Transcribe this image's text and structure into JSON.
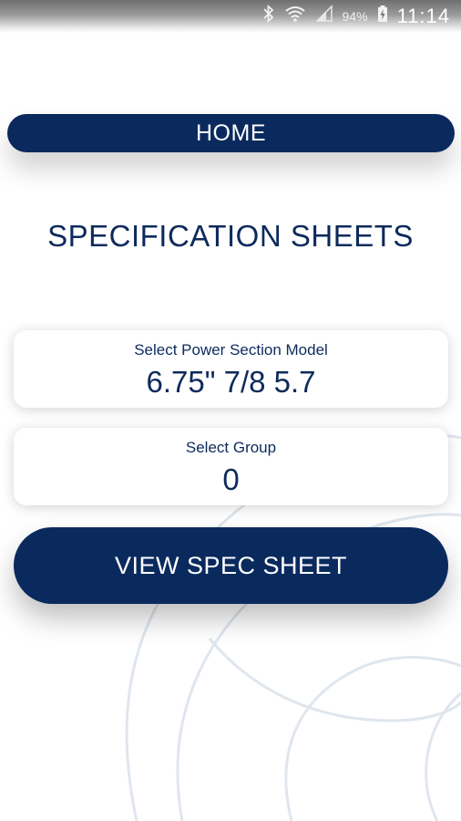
{
  "status_bar": {
    "battery": "94%",
    "time": "11:14",
    "icons": [
      "bluetooth-icon",
      "wifi-icon",
      "signal-icon",
      "battery-charging-icon"
    ]
  },
  "header": {
    "home_label": "HOME"
  },
  "page": {
    "title": "SPECIFICATION SHEETS"
  },
  "model_select": {
    "label": "Select Power Section Model",
    "value": "6.75\" 7/8 5.7"
  },
  "group_select": {
    "label": "Select Group",
    "value": "0"
  },
  "actions": {
    "view_label": "VIEW SPEC SHEET"
  },
  "colors": {
    "brand_navy": "#0a2a5e",
    "text_navy": "#0d2a5c",
    "background": "#ffffff"
  }
}
